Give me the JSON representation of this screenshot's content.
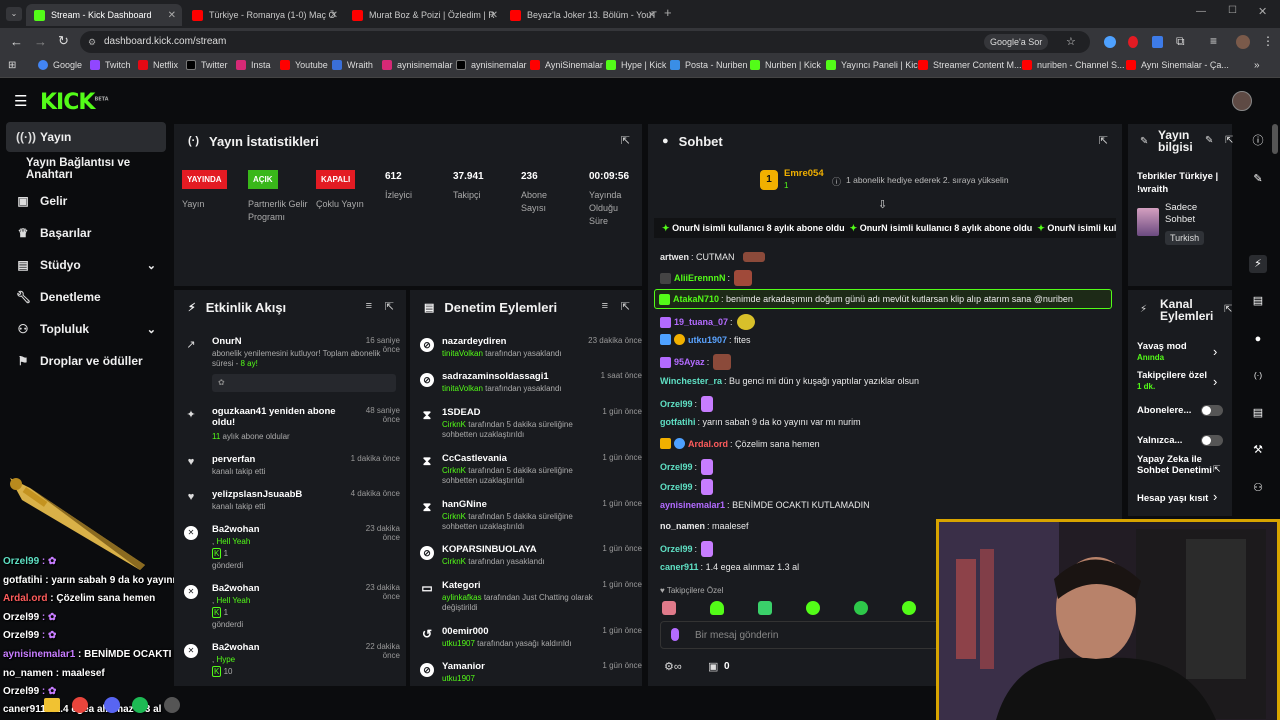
{
  "browser": {
    "tabs": [
      {
        "title": "Stream - Kick Dashboard",
        "color": "#53fc18"
      },
      {
        "title": "Türkiye - Romanya (1-0) Maç Ö",
        "color": "#ff0000"
      },
      {
        "title": "Murat Boz & Poizi | Özledim | R",
        "color": "#ff0000"
      },
      {
        "title": "Beyaz'la Joker 13. Bölüm - YouT",
        "color": "#ff0000"
      }
    ],
    "url": "dashboard.kick.com/stream",
    "google_btn": "Google'a Sor",
    "bookmarks": [
      "Google",
      "Twitch",
      "Netflix",
      "Twitter",
      "Insta",
      "Youtube",
      "Wraith",
      "aynisinemalar",
      "aynisinemalar",
      "AyniSinemalar",
      "Hype | Kick",
      "Posta - Nuriben",
      "Nuriben | Kick",
      "Yayıncı Paneli | Kick",
      "Streamer Content M...",
      "nuriben - Channel S...",
      "Aynı Sinemalar - Ça..."
    ]
  },
  "brand": {
    "logo": "KICK",
    "beta": "BETA"
  },
  "sidebar": {
    "items": [
      {
        "label": "Yayın",
        "icon": "broadcast-icon"
      },
      {
        "label": "Yayın Bağlantısı ve Anahtarı"
      },
      {
        "label": "Gelir",
        "icon": "wallet-icon"
      },
      {
        "label": "Başarılar",
        "icon": "trophy-icon"
      },
      {
        "label": "Stüdyo",
        "icon": "studio-icon"
      },
      {
        "label": "Denetleme",
        "icon": "wrench-icon"
      },
      {
        "label": "Topluluk",
        "icon": "community-icon"
      },
      {
        "label": "Droplar ve ödüller",
        "icon": "drops-icon"
      }
    ]
  },
  "stats": {
    "title": "Yayın İstatistikleri",
    "items": [
      {
        "badge": "YAYINDA",
        "badge_color": "#e31b23",
        "label": "Yayın"
      },
      {
        "badge": "AÇIK",
        "badge_color": "#39b71a",
        "label": "Partnerlik Gelir Programı"
      },
      {
        "badge": "KAPALI",
        "badge_color": "#e31b23",
        "label": "Çoklu Yayın"
      },
      {
        "value": "612",
        "label": "İzleyici"
      },
      {
        "value": "37.941",
        "label": "Takipçi"
      },
      {
        "value": "236",
        "label": "Abone Sayısı"
      },
      {
        "value": "00:09:56",
        "label": "Yayında Olduğu Süre"
      }
    ]
  },
  "activity": {
    "title": "Etkinlik Akışı",
    "events": [
      {
        "name": "OnurN",
        "time": "16 saniye önce",
        "text": "abonelik yenilemesini kutluyor! Toplam abonelik süresi - ",
        "months": "8 ay!"
      },
      {
        "name": "oguzkaan41 yeniden abone oldu!",
        "time": "48 saniye önce",
        "count": "11",
        "text": "aylık abone oldular"
      },
      {
        "name": "perverfan",
        "time": "1 dakika önce",
        "text": "kanalı takip etti"
      },
      {
        "name": "yelizpslasnJsuaabB",
        "time": "4 dakika önce",
        "text": "kanalı takip etti"
      },
      {
        "name": "Ba2wohan",
        "time": "23 dakika önce",
        "tag": "Hell Yeah",
        "count": "1",
        "text": "gönderdi"
      },
      {
        "name": "Ba2wohan",
        "time": "23 dakika önce",
        "tag": "Hell Yeah",
        "count": "1",
        "text": "gönderdi"
      },
      {
        "name": "Ba2wohan",
        "time": "22 dakika önce",
        "tag": "Hype",
        "count": "10"
      }
    ]
  },
  "moderation": {
    "title": "Denetim Eylemleri",
    "items": [
      {
        "name": "nazardeydiren",
        "time": "23 dakika önce",
        "actor": "tinitaVolkan",
        "text": "tarafından yasaklandı"
      },
      {
        "name": "sadrazaminsoldassagi1",
        "time": "1 saat önce",
        "actor": "tinitaVolkan",
        "text": "tarafından yasaklandı"
      },
      {
        "name": "1SDEAD",
        "time": "1 gün önce",
        "actor": "CirknK",
        "text": "tarafından 5 dakika süreliğine sohbetten uzaklaştırıldı"
      },
      {
        "name": "CcCastlevania",
        "time": "1 gün önce",
        "actor": "CirknK",
        "text": "tarafından 5 dakika süreliğine sohbetten uzaklaştırıldı"
      },
      {
        "name": "hanGNine",
        "time": "1 gün önce",
        "actor": "CirknK",
        "text": "tarafından 5 dakika süreliğine sohbetten uzaklaştırıldı"
      },
      {
        "name": "KOPARSINBUOLAYA",
        "time": "1 gün önce",
        "actor": "CirknK",
        "text": "tarafından yasaklandı"
      },
      {
        "name": "Kategori",
        "time": "1 gün önce",
        "actor": "aylinkafkas",
        "text": "tarafından Just Chatting olarak değiştirildi"
      },
      {
        "name": "00emir000",
        "time": "1 gün önce",
        "actor": "utku1907",
        "text": "tarafından yasağı kaldırıldı"
      },
      {
        "name": "Yamanior",
        "time": "1 gün önce",
        "actor": "utku1907",
        "text": ""
      }
    ]
  },
  "chat": {
    "title": "Sohbet",
    "gift": {
      "user": "Emre054",
      "count": "1",
      "text": "1 abonelik hediye ederek 2. sıraya yükselin"
    },
    "banner": "OnurN isimli kullanıcı 8 aylık abone oldu",
    "messages": [
      {
        "user": "artwen",
        "color": "#ffffff",
        "text": "CUTMAN"
      },
      {
        "user": "AliiErennnN",
        "color": "#53fc18",
        "text": ""
      },
      {
        "user": "AtakaN710",
        "color": "#53fc18",
        "text": "benimde arkadaşımın doğum günü adı mevlüt kutlarsan klip alıp atarım sana @nuriben"
      },
      {
        "user": "19_tuana_07",
        "color": "#b36bff",
        "text": ""
      },
      {
        "user": "utku1907",
        "color": "#5aa3ff",
        "text": "fites"
      },
      {
        "user": "95Ayaz",
        "color": "#b36bff",
        "text": ""
      },
      {
        "user": "Winchester_ra",
        "color": "#5fe0c4",
        "text": "Bu genci mi dün y kuşağı yaptılar yazıklar olsun"
      },
      {
        "user": "Orzel99",
        "color": "#5fe0c4",
        "text": ""
      },
      {
        "user": "gotfatihi",
        "color": "#5fe0c4",
        "text": "yarın sabah 9 da ko yayını var mı nurim"
      },
      {
        "user": "Ardal.ord",
        "color": "#ff5c5c",
        "text": "Çözelim sana hemen"
      },
      {
        "user": "Orzel99",
        "color": "#5fe0c4",
        "text": ""
      },
      {
        "user": "Orzel99",
        "color": "#5fe0c4",
        "text": ""
      },
      {
        "user": "aynisinemalar1",
        "color": "#b36bff",
        "text": "BENİMDE OCAKTI KUTLAMADIN"
      },
      {
        "user": "no_namen",
        "color": "#ffffff",
        "text": "maalesef"
      },
      {
        "user": "Orzel99",
        "color": "#5fe0c4",
        "text": ""
      },
      {
        "user": "caner911",
        "color": "#5fe0c4",
        "text": "1.4 egea alınmaz 1.3 al"
      }
    ],
    "followers_only": "Takipçilere Özel",
    "placeholder": "Bir mesaj gönderin",
    "counter": "0"
  },
  "info": {
    "title": "Yayın bilgisi",
    "stream_title": "Tebrikler Türkiye | !wraith",
    "category": "Sadece Sohbet",
    "language": "Turkish"
  },
  "channel_actions": {
    "title": "Kanal Eylemleri",
    "items": [
      {
        "label": "Yavaş mod",
        "sub": "Anında"
      },
      {
        "label": "Takipçilere özel",
        "sub": "1 dk."
      },
      {
        "label": "Abonelere..."
      },
      {
        "label": "Yalnızca..."
      },
      {
        "label": "Yapay Zeka ile Sohbet Denetimi"
      },
      {
        "label": "Hesap yaşı kısıt"
      }
    ]
  },
  "overlay": {
    "lines": [
      {
        "user": "Orzel99",
        "text": ""
      },
      {
        "user": "gotfatihi",
        "text": "yarın sabah 9 da ko yayını var mı nurim"
      },
      {
        "user": "Ardal.ord",
        "text": "Çözelim sana hemen"
      },
      {
        "user": "Orzel99",
        "text": ""
      },
      {
        "user": "Orzel99",
        "text": ""
      },
      {
        "user": "aynisinemalar1",
        "text": "BENİMDE OCAKTI KUTLAMADIN"
      },
      {
        "user": "no_namen",
        "text": "maalesef"
      },
      {
        "user": "Orzel99",
        "text": ""
      },
      {
        "user": "caner911",
        "text": "1.4 egea alınmaz 1.3 al"
      }
    ]
  }
}
